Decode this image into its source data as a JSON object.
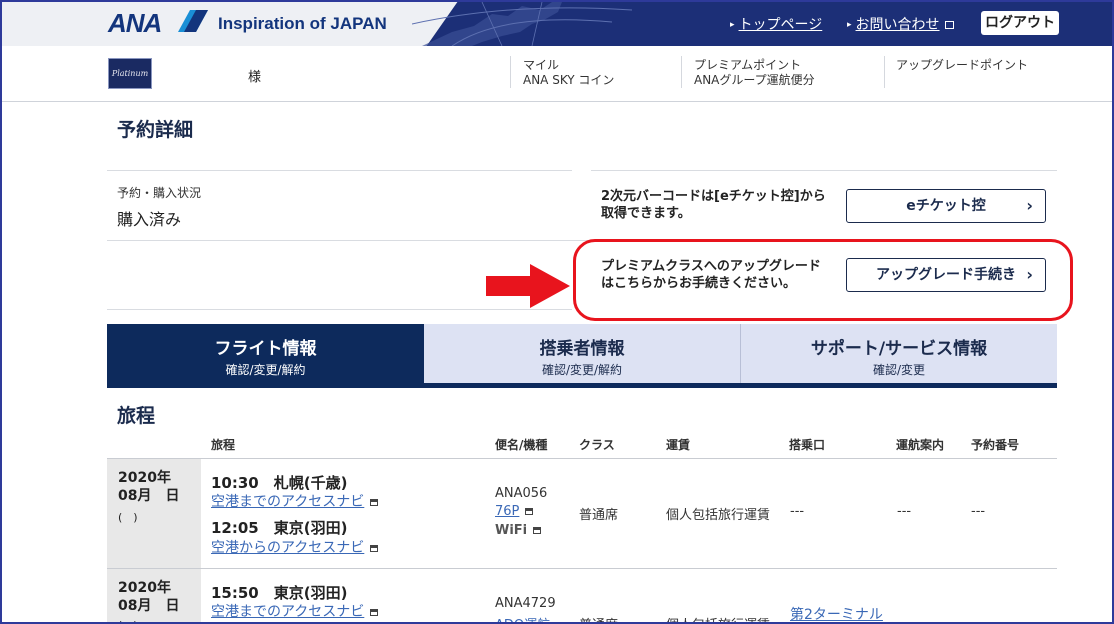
{
  "header": {
    "logo": "ANA",
    "tagline": "Inspiration of JAPAN",
    "links": {
      "top": "トップページ",
      "contact": "お問い合わせ"
    },
    "logout": "ログアウト"
  },
  "member": {
    "card_text": "Platinum",
    "name": "様",
    "miles_label": "マイル",
    "sky_coin_label": "ANA SKY コイン",
    "premium_points_label": "プレミアムポイント",
    "group_flight_label": "ANAグループ運航便分",
    "upgrade_points_label": "アップグレードポイント"
  },
  "reservation": {
    "title": "予約詳細",
    "status_label": "予約・購入状況",
    "status_value": "購入済み",
    "barcode_note_1": "2次元バーコードは[eチケット控]から",
    "barcode_note_2": "取得できます。",
    "eticket_button": "eチケット控",
    "upgrade_note_1": "プレミアムクラスへのアップグレード",
    "upgrade_note_2": "はこちらからお手続きください。",
    "upgrade_button": "アップグレード手続き"
  },
  "tabs": [
    {
      "label": "フライト情報",
      "sub": "確認/変更/解約",
      "active": true
    },
    {
      "label": "搭乗者情報",
      "sub": "確認/変更/解約",
      "active": false
    },
    {
      "label": "サポート/サービス情報",
      "sub": "確認/変更",
      "active": false
    }
  ],
  "itinerary": {
    "title": "旅程",
    "columns": [
      "旅程",
      "便名/機種",
      "クラス",
      "運賃",
      "搭乗口",
      "運航案内",
      "予約番号"
    ],
    "rows": [
      {
        "year": "2020年",
        "month_day": "08月　日",
        "weekday": "(　)",
        "dep_time": "10:30　札幌(千歳)",
        "dep_link": "空港までのアクセスナビ",
        "arr_time": "12:05　東京(羽田)",
        "arr_link": "空港からのアクセスナビ",
        "flight": "ANA056",
        "aircraft": "76P",
        "wifi": "WiFi",
        "class": "普通席",
        "fare": "個人包括旅行運賃",
        "gate": "---",
        "status": "---",
        "booking": "---"
      },
      {
        "year": "2020年",
        "month_day": "08月　日",
        "weekday": "(　)",
        "dep_time": "15:50　東京(羽田)",
        "dep_link": "空港までのアクセスナビ",
        "flight": "ANA4729",
        "aircraft": "ADO運航",
        "class": "普通席",
        "fare": "個人包括旅行運賃",
        "gate": "第2ターミナル"
      }
    ]
  },
  "colors": {
    "header_bg": "#1c2f77",
    "navy": "#0d2a5c",
    "tab_inactive": "#dde2f3",
    "link": "#3a68b6",
    "highlight": "#e8141d"
  }
}
